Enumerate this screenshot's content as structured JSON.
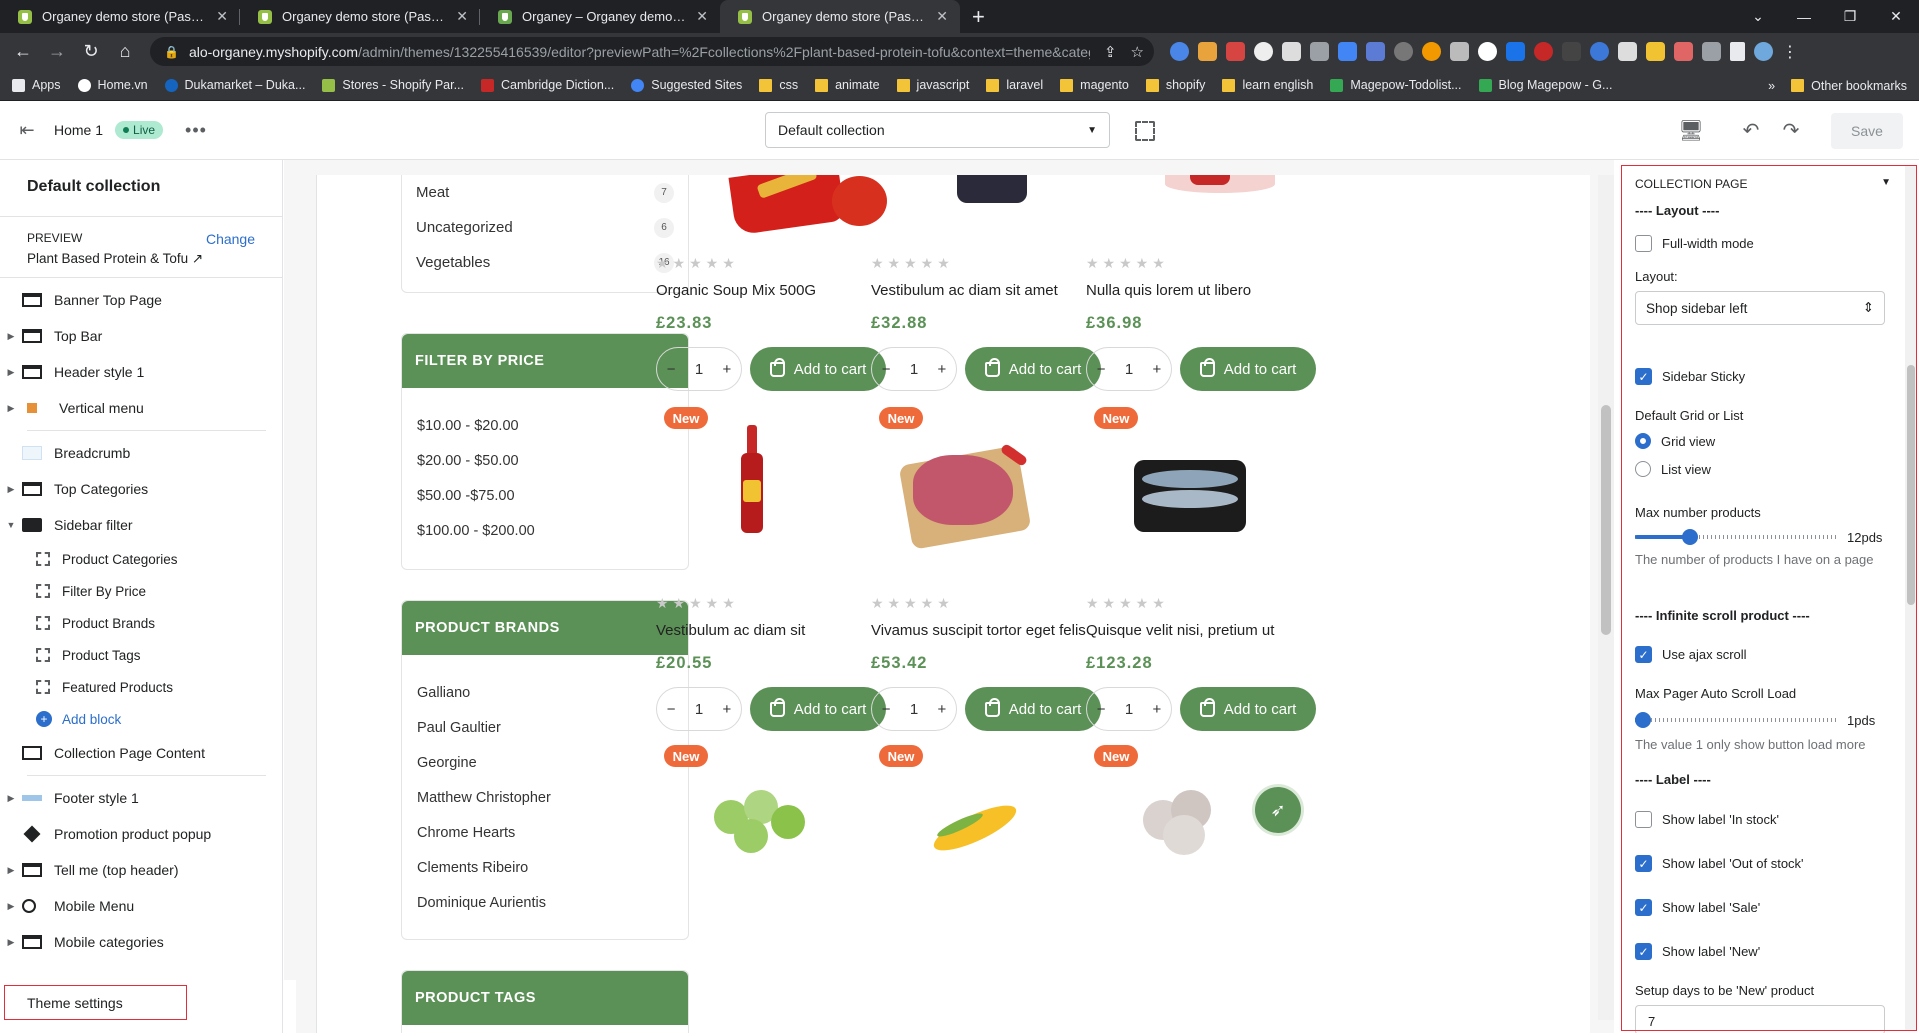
{
  "browser": {
    "tabs": [
      {
        "title": "Organey demo store (Password:",
        "active": false
      },
      {
        "title": "Organey demo store (Password:",
        "active": false
      },
      {
        "title": "Organey – Organey demo store",
        "active": false
      },
      {
        "title": "Organey demo store (Password:",
        "active": true
      }
    ],
    "url_host": "alo-organey.myshopify.com",
    "url_path": "/admin/themes/132255416539/editor?previewPath=%2Fcollections%2Fplant-based-protein-tofu&context=theme&categ...",
    "bookmarks": [
      "Apps",
      "Home.vn",
      "Dukamarket – Duka...",
      "Stores - Shopify Par...",
      "Cambridge Diction...",
      "Suggested Sites",
      "css",
      "animate",
      "javascript",
      "laravel",
      "magento",
      "shopify",
      "learn english",
      "Magepow-Todolist...",
      "Blog Magepow - G..."
    ],
    "other_bookmarks": "Other bookmarks"
  },
  "editor": {
    "page_name": "Home 1",
    "live_badge": "Live",
    "template_select": "Default collection",
    "save_label": "Save"
  },
  "left_sidebar": {
    "title": "Default collection",
    "preview_label": "PREVIEW",
    "change_link": "Change",
    "preview_value": "Plant Based Protein & Tofu",
    "sections": [
      {
        "label": "Banner Top Page",
        "caret": false
      },
      {
        "label": "Top Bar",
        "caret": true
      },
      {
        "label": "Header style 1",
        "caret": true
      },
      {
        "label": "Vertical menu",
        "caret": true
      }
    ],
    "sections2": [
      {
        "label": "Breadcrumb",
        "caret": false
      },
      {
        "label": "Top Categories",
        "caret": true
      },
      {
        "label": "Sidebar filter",
        "caret": true
      }
    ],
    "blocks": [
      "Product Categories",
      "Filter By Price",
      "Product Brands",
      "Product Tags",
      "Featured Products"
    ],
    "add_block": "Add block",
    "content_section": "Collection Page Content",
    "sections3": [
      {
        "label": "Footer style 1",
        "caret": true
      },
      {
        "label": "Promotion product popup",
        "caret": false
      },
      {
        "label": "Tell me (top header)",
        "caret": true
      },
      {
        "label": "Mobile Menu",
        "caret": true
      },
      {
        "label": "Mobile categories",
        "caret": true
      }
    ],
    "theme_settings": "Theme settings"
  },
  "store": {
    "categories": [
      {
        "name": "Meat",
        "count": "7"
      },
      {
        "name": "Uncategorized",
        "count": "6"
      },
      {
        "name": "Vegetables",
        "count": "16"
      }
    ],
    "filter_by_price": "FILTER BY PRICE",
    "prices": [
      "$10.00 - $20.00",
      "$20.00 - $50.00",
      "$50.00 -$75.00",
      "$100.00 - $200.00"
    ],
    "product_brands": "PRODUCT BRANDS",
    "brands": [
      "Galliano",
      "Paul Gaultier",
      "Georgine",
      "Matthew Christopher",
      "Chrome Hearts",
      "Clements Ribeiro",
      "Dominique Aurientis"
    ],
    "product_tags": "PRODUCT TAGS",
    "new_label": "New",
    "add_to_cart": "Add to cart",
    "qty": "1",
    "products": [
      {
        "name": "Organic Soup Mix 500G",
        "price": "£23.83"
      },
      {
        "name": "Vestibulum ac diam sit amet",
        "price": "£32.88"
      },
      {
        "name": "Nulla quis lorem ut libero",
        "price": "£36.98"
      },
      {
        "name": "Vestibulum ac diam sit",
        "price": "£20.55"
      },
      {
        "name": "Vivamus suscipit tortor eget felis",
        "price": "£53.42"
      },
      {
        "name": "Quisque velit nisi, pretium ut",
        "price": "£123.28"
      }
    ]
  },
  "settings": {
    "group_title": "COLLECTION PAGE",
    "layout_heading": "---- Layout ----",
    "full_width": "Full-width mode",
    "layout_label": "Layout:",
    "layout_value": "Shop sidebar left",
    "sidebar_sticky": "Sidebar Sticky",
    "default_grid_label": "Default Grid or List",
    "grid_view": "Grid view",
    "list_view": "List view",
    "max_products_label": "Max number products",
    "max_products_value": "12pds",
    "max_products_level": 0.25,
    "max_products_hint": "The number of products I have on a page",
    "infinite_heading": "---- Infinite scroll product ----",
    "use_ajax": "Use ajax scroll",
    "max_pager_label": "Max Pager Auto Scroll Load",
    "max_pager_value": "1pds",
    "max_pager_level": 0.0,
    "max_pager_hint": "The value 1 only show button load more",
    "label_heading": "---- Label ----",
    "show_in_stock": "Show label 'In stock'",
    "show_out_of_stock": "Show label 'Out of stock'",
    "show_sale": "Show label 'Sale'",
    "show_new": "Show label 'New'",
    "new_days_label": "Setup days to be 'New' product",
    "new_days_value": "7"
  }
}
